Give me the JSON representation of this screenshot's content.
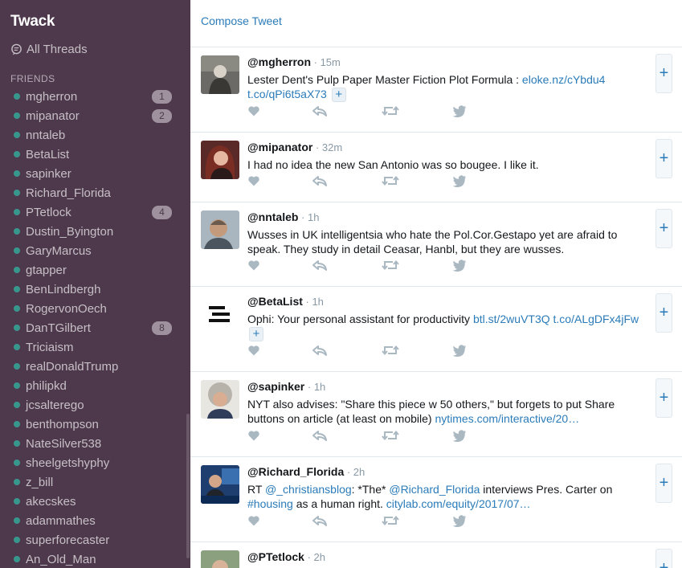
{
  "app": {
    "title": "Twack"
  },
  "sidebar": {
    "all_threads_label": "All Threads",
    "section_label": "FRIENDS",
    "friends": [
      {
        "name": "mgherron",
        "badge": "1"
      },
      {
        "name": "mipanator",
        "badge": "2"
      },
      {
        "name": "nntaleb",
        "badge": ""
      },
      {
        "name": "BetaList",
        "badge": ""
      },
      {
        "name": "sapinker",
        "badge": ""
      },
      {
        "name": "Richard_Florida",
        "badge": ""
      },
      {
        "name": "PTetlock",
        "badge": "4"
      },
      {
        "name": "Dustin_Byington",
        "badge": ""
      },
      {
        "name": "GaryMarcus",
        "badge": ""
      },
      {
        "name": "gtapper",
        "badge": ""
      },
      {
        "name": "BenLindbergh",
        "badge": ""
      },
      {
        "name": "RogervonOech",
        "badge": ""
      },
      {
        "name": "DanTGilbert",
        "badge": "8"
      },
      {
        "name": "Triciaism",
        "badge": ""
      },
      {
        "name": "realDonaldTrump",
        "badge": ""
      },
      {
        "name": "philipkd",
        "badge": ""
      },
      {
        "name": "jcsalterego",
        "badge": ""
      },
      {
        "name": "benthompson",
        "badge": ""
      },
      {
        "name": "NateSilver538",
        "badge": ""
      },
      {
        "name": "sheelgetshyphy",
        "badge": ""
      },
      {
        "name": "z_bill",
        "badge": ""
      },
      {
        "name": "akecskes",
        "badge": ""
      },
      {
        "name": "adammathes",
        "badge": ""
      },
      {
        "name": "superforecaster",
        "badge": ""
      },
      {
        "name": "An_Old_Man",
        "badge": ""
      }
    ]
  },
  "main": {
    "compose_label": "Compose Tweet",
    "more_label": "+",
    "add_label": "+",
    "tweets": [
      {
        "handle": "@mgherron",
        "time": "15m",
        "text": [
          {
            "t": "Lester Dent's Pulp Paper Master Fiction Plot Formula : ",
            "link": false
          },
          {
            "t": "eloke.nz/cYbdu4",
            "link": true
          },
          {
            "t": " ",
            "link": false
          },
          {
            "t": "t.co/qPi6t5aX73",
            "link": true
          }
        ],
        "more": true
      },
      {
        "handle": "@mipanator",
        "time": "32m",
        "text": [
          {
            "t": "I had no idea the new San Antonio was so bougee. I like it.",
            "link": false
          }
        ],
        "more": false
      },
      {
        "handle": "@nntaleb",
        "time": "1h",
        "text": [
          {
            "t": "Wusses in UK intelligentsia who hate the Pol.Cor.Gestapo yet are afraid to speak. They study in detail Ceasar, Hanbl, but they are wusses.",
            "link": false
          }
        ],
        "more": false
      },
      {
        "handle": "@BetaList",
        "time": "1h",
        "text": [
          {
            "t": "Ophi: Your personal assistant for productivity ",
            "link": false
          },
          {
            "t": "btl.st/2wuVT3Q",
            "link": true
          },
          {
            "t": " ",
            "link": false
          },
          {
            "t": "t.co/ALgDFx4jFw",
            "link": true
          }
        ],
        "more": true
      },
      {
        "handle": "@sapinker",
        "time": "1h",
        "text": [
          {
            "t": "NYT also advises: \"Share this piece w 50 others,\" but forgets to put Share buttons on article (at least on mobile) ",
            "link": false
          },
          {
            "t": "nytimes.com/interactive/20…",
            "link": true
          }
        ],
        "more": false
      },
      {
        "handle": "@Richard_Florida",
        "time": "2h",
        "text": [
          {
            "t": "RT ",
            "link": false
          },
          {
            "t": "@_christiansblog",
            "link": true
          },
          {
            "t": ": *The* ",
            "link": false
          },
          {
            "t": "@Richard_Florida",
            "link": true
          },
          {
            "t": " interviews Pres. Carter on ",
            "link": false
          },
          {
            "t": "#housing",
            "link": true
          },
          {
            "t": " as a human right. ",
            "link": false
          },
          {
            "t": "citylab.com/equity/2017/07…",
            "link": true
          }
        ],
        "more": false
      },
      {
        "handle": "@PTetlock",
        "time": "2h",
        "text": [
          {
            "t": "",
            "link": false
          }
        ],
        "more": false
      }
    ]
  },
  "colors": {
    "sidebar_bg": "#4d394b",
    "presence_dot": "#38978d",
    "link": "#2b7bb9",
    "action_icon": "#aab8c2"
  }
}
